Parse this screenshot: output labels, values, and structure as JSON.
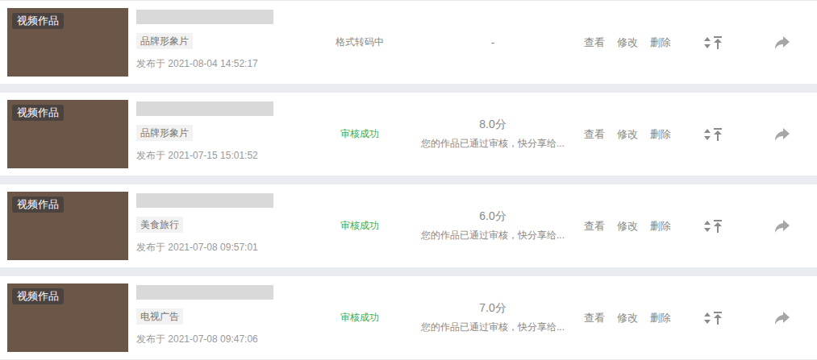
{
  "works": [
    {
      "badge": "视频作品",
      "category": "品牌形象片",
      "published": "发布于 2021-08-04 14:52:17",
      "status": "格式转码中",
      "status_color": "#888888",
      "score": "-",
      "note": "",
      "actions": [
        "查看",
        "修改",
        "删除"
      ]
    },
    {
      "badge": "视频作品",
      "category": "品牌形象片",
      "published": "发布于 2021-07-15 15:01:52",
      "status": "审核成功",
      "status_color": "#2cb05a",
      "score": "8.0分",
      "note": "您的作品已通过审核，快分享给...",
      "actions": [
        "查看",
        "修改",
        "删除"
      ]
    },
    {
      "badge": "视频作品",
      "category": "美食旅行",
      "published": "发布于 2021-07-08 09:57:01",
      "status": "审核成功",
      "status_color": "#2cb05a",
      "score": "6.0分",
      "note": "您的作品已通过审核，快分享给...",
      "actions": [
        "查看",
        "修改",
        "删除"
      ]
    },
    {
      "badge": "视频作品",
      "category": "电视广告",
      "published": "发布于 2021-07-08 09:47:06",
      "status": "审核成功",
      "status_color": "#2cb05a",
      "score": "7.0分",
      "note": "您的作品已通过审核，快分享给...",
      "actions": [
        "查看",
        "修改",
        "删除"
      ]
    }
  ]
}
